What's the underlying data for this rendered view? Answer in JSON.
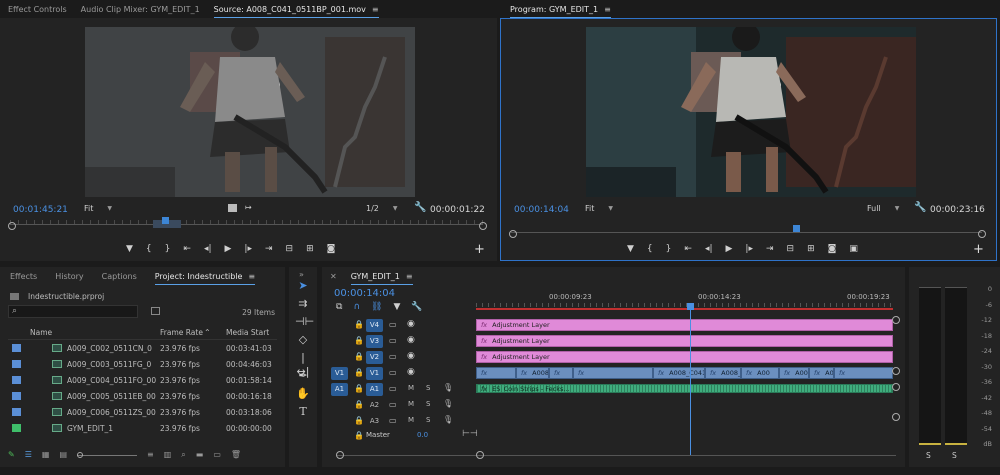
{
  "source_panel": {
    "tabs": [
      "Effect Controls",
      "Audio Clip Mixer: GYM_EDIT_1",
      "Source: A008_C041_0511BP_001.mov"
    ],
    "active_tab": 2,
    "timecode_current": "00:01:45:21",
    "fit_label": "Fit",
    "resolution": "1/2",
    "timecode_duration": "00:00:01:22"
  },
  "program_panel": {
    "title": "Program: GYM_EDIT_1",
    "timecode_current": "00:00:14:04",
    "fit_label": "Fit",
    "resolution": "Full",
    "timecode_duration": "00:00:23:16"
  },
  "project_panel": {
    "tabs": [
      "Effects",
      "History",
      "Captions",
      "Project: Indestructible"
    ],
    "active_tab": 3,
    "project_file": "Indestructible.prproj",
    "item_count": "29 Items",
    "columns": {
      "name": "Name",
      "frame_rate": "Frame Rate",
      "media_start": "Media Start"
    },
    "rows": [
      {
        "name": "A009_C002_0511CN_0",
        "rate": "23.976 fps",
        "start": "00:03:41:03",
        "color": "#5b8fd6"
      },
      {
        "name": "A009_C003_0511FG_0",
        "rate": "23.976 fps",
        "start": "00:04:46:03",
        "color": "#5b8fd6"
      },
      {
        "name": "A009_C004_0511FO_00",
        "rate": "23.976 fps",
        "start": "00:01:58:14",
        "color": "#5b8fd6"
      },
      {
        "name": "A009_C005_0511EB_00",
        "rate": "23.976 fps",
        "start": "00:00:16:18",
        "color": "#5b8fd6"
      },
      {
        "name": "A009_C006_0511ZS_00",
        "rate": "23.976 fps",
        "start": "00:03:18:06",
        "color": "#5b8fd6"
      },
      {
        "name": "GYM_EDIT_1",
        "rate": "23.976 fps",
        "start": "00:00:00:00",
        "color": "#3fbf6a"
      }
    ]
  },
  "timeline": {
    "sequence_tab": "GYM_EDIT_1",
    "timecode": "00:00:14:04",
    "ruler": [
      "00:00:09:23",
      "00:00:14:23",
      "00:00:19:23"
    ],
    "video_tracks": [
      "V4",
      "V3",
      "V2",
      "V1"
    ],
    "audio_tracks": [
      "A1",
      "A2",
      "A3"
    ],
    "source_v": "V1",
    "source_a": "A1",
    "master_label": "Master",
    "master_value": "0.0",
    "adjustment_layer": "Adjustment Layer",
    "v1_clips": [
      "A008...",
      "",
      "A008_C041_0511",
      "A008_C041_0",
      "A00",
      "A009_C00",
      "A008...",
      ""
    ],
    "audio_clip": "ES_Coin Strips - Fecks..."
  },
  "meter": {
    "scale": [
      "0",
      "-6",
      "-12",
      "-18",
      "-24",
      "-30",
      "-36",
      "-42",
      "-48",
      "-54",
      "dB"
    ],
    "solo_labels": [
      "S",
      "S"
    ]
  },
  "colors": {
    "accent": "#4a90e2",
    "pink_clip": "#e08ad8",
    "video_clip": "#6b8fbf",
    "audio_clip": "#3fae7e"
  }
}
